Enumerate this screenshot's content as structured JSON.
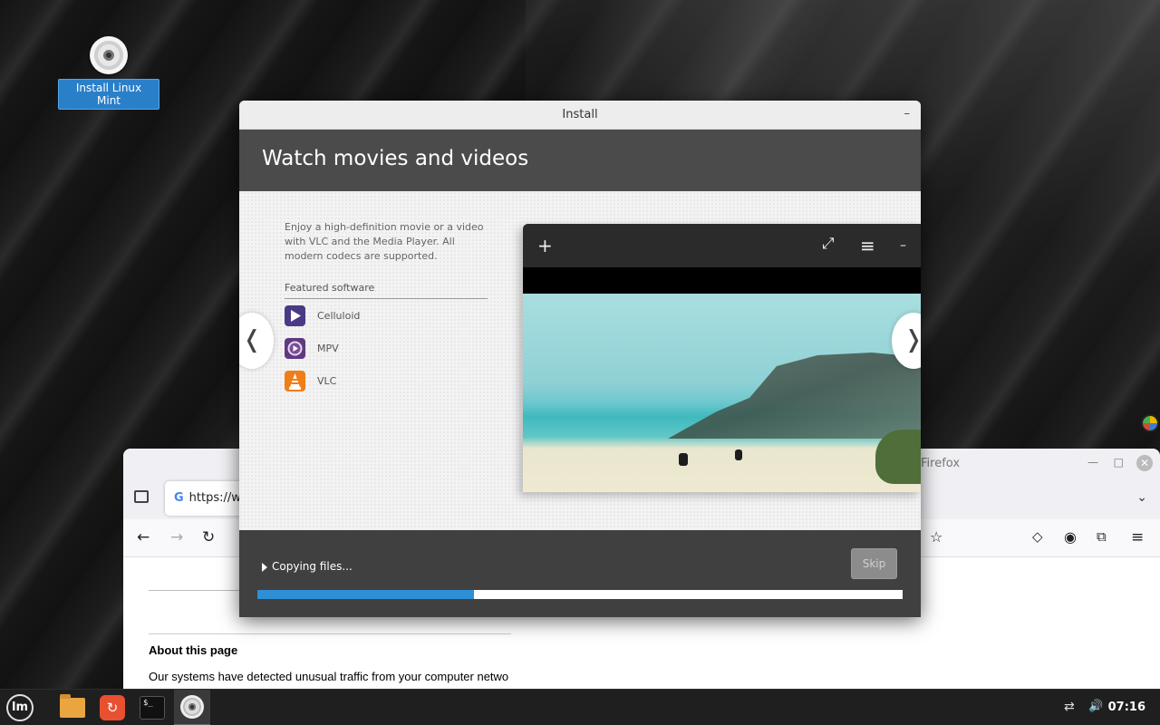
{
  "desktop": {
    "icon_label": "Install Linux Mint"
  },
  "firefox": {
    "title": "Firefox",
    "url_partial": "https://w",
    "min_symbol": "—",
    "max_symbol": "□",
    "close_symbol": "✕",
    "content": {
      "heading": "About this page",
      "paragraph": "Our systems have detected unusual traffic from your computer netwo"
    }
  },
  "installer": {
    "window_title": "Install",
    "minimize_symbol": "–",
    "heading": "Watch movies and videos",
    "description": "Enjoy a high-definition movie or a video with VLC and the Media Player. All modern codecs are supported.",
    "featured_label": "Featured software",
    "apps": [
      {
        "name": "Celluloid",
        "color": "#5b3d8c"
      },
      {
        "name": "MPV",
        "color": "#6a3f8a"
      },
      {
        "name": "VLC",
        "color": "#f08a1c"
      }
    ],
    "prev_symbol": "❬",
    "next_symbol": "❭",
    "status_text": "Copying files...",
    "skip_label": "Skip",
    "progress": 0.335
  },
  "player": {
    "add_symbol": "+",
    "fullscreen_symbol": "⤢",
    "menu_symbol": "≡",
    "min_symbol": "–"
  },
  "taskbar": {
    "clock": "07:16",
    "mint_logo": "lm",
    "terminal_glyph": "$_",
    "network_symbol": "⇄",
    "volume_symbol": "🔊"
  },
  "colors": {
    "accent": "#2d8fd6",
    "header_bg": "#4b4b4b",
    "footer_bg": "#404040"
  }
}
